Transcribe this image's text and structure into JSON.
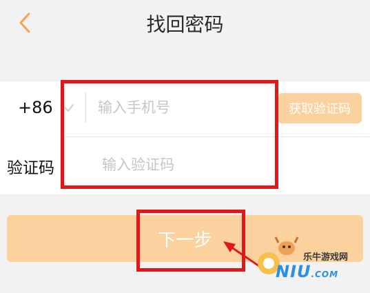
{
  "header": {
    "title": "找回密码"
  },
  "form": {
    "country_code": "+86",
    "phone_placeholder": "输入手机号",
    "get_code_label": "获取验证码",
    "code_label": "验证码",
    "code_placeholder": "输入验证码"
  },
  "actions": {
    "next_label": "下一步"
  },
  "watermark": {
    "name": "乐牛游戏网",
    "brand": "NIU",
    "domain": ".COM"
  },
  "colors": {
    "accent": "#f5a34b",
    "button_bg": "#fbd19e",
    "highlight": "#e01818"
  }
}
